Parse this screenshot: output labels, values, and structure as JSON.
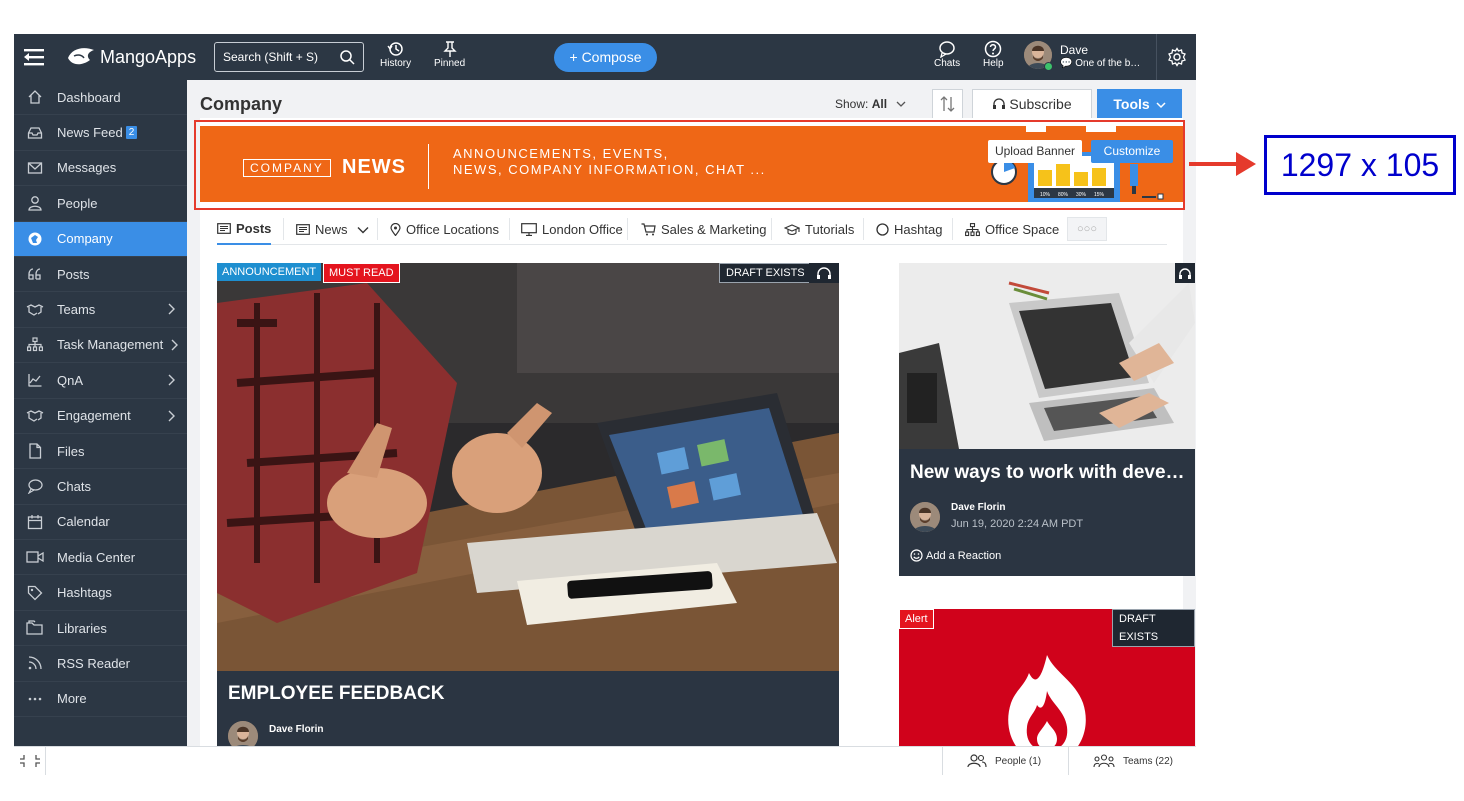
{
  "topbar": {
    "logo": "MangoApps",
    "search_placeholder": "Search (Shift + S)",
    "history_label": "History",
    "pinned_label": "Pinned",
    "compose_label": "+ Compose",
    "chats_label": "Chats",
    "help_label": "Help",
    "user_name": "Dave",
    "user_status": "One of the b…"
  },
  "sidebar": {
    "items": [
      {
        "label": "Dashboard",
        "icon": "home-icon"
      },
      {
        "label": "News Feed",
        "icon": "inbox-icon",
        "badge": "2"
      },
      {
        "label": "Messages",
        "icon": "mail-icon"
      },
      {
        "label": "People",
        "icon": "person-icon"
      },
      {
        "label": "Company",
        "icon": "company-icon",
        "active": true
      },
      {
        "label": "Posts",
        "icon": "quote-icon"
      },
      {
        "label": "Teams",
        "icon": "handshake-icon",
        "chevron": true
      },
      {
        "label": "Task Management",
        "icon": "org-chart-icon",
        "chevron": true
      },
      {
        "label": "QnA",
        "icon": "chart-icon",
        "chevron": true
      },
      {
        "label": "Engagement",
        "icon": "handshake-icon",
        "chevron": true
      },
      {
        "label": "Files",
        "icon": "file-icon"
      },
      {
        "label": "Chats",
        "icon": "chat-bubble-icon"
      },
      {
        "label": "Calendar",
        "icon": "calendar-icon"
      },
      {
        "label": "Media Center",
        "icon": "video-camera-icon"
      },
      {
        "label": "Hashtags",
        "icon": "tag-icon"
      },
      {
        "label": "Libraries",
        "icon": "folders-icon"
      },
      {
        "label": "RSS Reader",
        "icon": "rss-icon"
      },
      {
        "label": "More",
        "icon": "more-dots-icon"
      }
    ]
  },
  "header": {
    "title": "Company",
    "show_prefix": "Show:",
    "show_value": "All",
    "subscribe_label": "Subscribe",
    "tools_label": "Tools"
  },
  "banner": {
    "company": "COMPANY",
    "news": "NEWS",
    "line1": "ANNOUNCEMENTS, EVENTS,",
    "line2": "NEWS, COMPANY INFORMATION, CHAT ...",
    "upload_label": "Upload Banner",
    "customize_label": "Customize",
    "chart_ticks": [
      "10%",
      "80%",
      "30%",
      "15%"
    ]
  },
  "tabs": [
    {
      "label": "Posts",
      "icon": "posts-icon",
      "active": true
    },
    {
      "label": "News",
      "icon": "news-icon",
      "dropdown": true
    },
    {
      "label": "Office Locations",
      "icon": "location-pin-icon"
    },
    {
      "label": "London Office",
      "icon": "monitor-icon"
    },
    {
      "label": "Sales & Marketing",
      "icon": "cart-icon"
    },
    {
      "label": "Tutorials",
      "icon": "graduation-cap-icon"
    },
    {
      "label": "Hashtag",
      "icon": "circle-icon"
    },
    {
      "label": "Office Space",
      "icon": "org-chart-icon"
    }
  ],
  "tab_more": "○○○",
  "main_card": {
    "tag_announcement": "ANNOUNCEMENT",
    "tag_must_read": "MUST READ",
    "draft": "DRAFT EXISTS",
    "title": "EMPLOYEE FEEDBACK",
    "author": "Dave Florin"
  },
  "side_card": {
    "title": "New ways to work with deve…",
    "author": "Dave Florin",
    "date": "Jun 19, 2020 2:24 AM PDT",
    "reaction": "Add a Reaction"
  },
  "alert_card": {
    "tag": "Alert",
    "draft": "DRAFT EXISTS"
  },
  "footer": {
    "people": "People (1)",
    "teams": "Teams (22)"
  },
  "annotation": {
    "dimensions": "1297 x 105"
  },
  "colors": {
    "topbar": "#2c3744",
    "accent": "#3a8ee6",
    "banner": "#ef6716",
    "alert": "#d0021b",
    "annotation_red": "#e53a2c",
    "annotation_blue": "#0000cc"
  }
}
